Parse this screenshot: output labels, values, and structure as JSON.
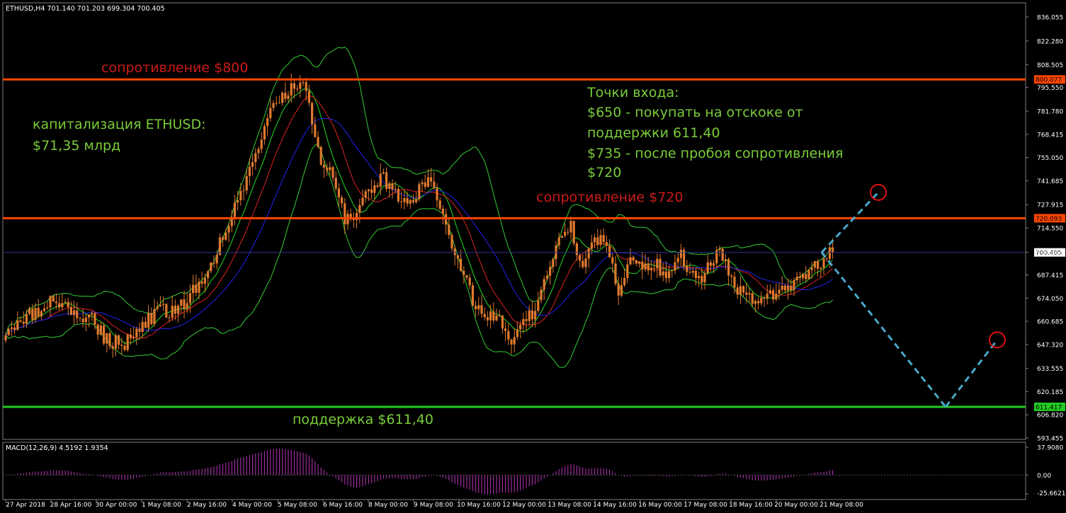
{
  "header": {
    "symbol_info": "ETHUSD,H4  701.140 701.203 699.304 700.405"
  },
  "macd": {
    "info": "MACD(12,26,9) 4.5192 1.9354"
  },
  "colors": {
    "background": "#000000",
    "candle": "#e07a2f",
    "resistance": "#ff4500",
    "support": "#22cc22",
    "annotation_green": "#7acc3a",
    "annotation_red": "#cc1a1a",
    "projection": "#4aa8c8",
    "bb": "#33cc33",
    "ma_fast": "#22dd22",
    "ma_red": "#dd2222",
    "ma_blue": "#2222ee",
    "macd": "#bb33bb",
    "axis_text": "#ffffff",
    "grid_frame": "#808080"
  },
  "annotations": {
    "res800": "сопротивление $800",
    "res720": "сопротивление $720",
    "support": "поддержка $611,40",
    "cap_line1": "капитализация ETHUSD:",
    "cap_line2": "$71,35 млрд",
    "entry_line1": "Точки входа:",
    "entry_line2": "$650 - покупать на отскоке от",
    "entry_line3": "поддержки 611,40",
    "entry_line4": "$735 - после пробоя сопротивления",
    "entry_line5": "$720"
  },
  "chart_data": {
    "type": "candlestick",
    "symbol": "ETHUSD",
    "timeframe": "H4",
    "y_ticks": [
      "836.055",
      "822.280",
      "808.505",
      "795.550",
      "781.780",
      "768.415",
      "755.050",
      "741.685",
      "727.915",
      "714.550",
      "700.405",
      "687.415",
      "674.050",
      "660.685",
      "647.320",
      "633.555",
      "620.185",
      "606.820",
      "593.455"
    ],
    "levels": [
      {
        "name": "resistance-800",
        "value": 800.077,
        "label": "800.077"
      },
      {
        "name": "resistance-720",
        "value": 720.093,
        "label": "720.093"
      },
      {
        "name": "support-611",
        "value": 611.417,
        "label": "611.417"
      }
    ],
    "current_price": {
      "value": 700.405,
      "label": "700.405"
    },
    "x_labels": [
      "27 Apr 2018",
      "28 Apr 16:00",
      "30 Apr 00:00",
      "1 May 08:00",
      "2 May 16:00",
      "4 May 00:00",
      "5 May 08:00",
      "6 May 16:00",
      "8 May 00:00",
      "9 May 08:00",
      "10 May 16:00",
      "12 May 00:00",
      "13 May 08:00",
      "14 May 16:00",
      "16 May 00:00",
      "17 May 08:00",
      "18 May 16:00",
      "20 May 00:00",
      "21 May 08:00"
    ],
    "close_path": [
      [
        0,
        655
      ],
      [
        8,
        664
      ],
      [
        16,
        672
      ],
      [
        22,
        666
      ],
      [
        28,
        664
      ],
      [
        34,
        650
      ],
      [
        40,
        648
      ],
      [
        46,
        660
      ],
      [
        52,
        666
      ],
      [
        58,
        668
      ],
      [
        62,
        675
      ],
      [
        68,
        690
      ],
      [
        78,
        730
      ],
      [
        84,
        760
      ],
      [
        90,
        785
      ],
      [
        95,
        795
      ],
      [
        100,
        800
      ],
      [
        102,
        785
      ],
      [
        106,
        750
      ],
      [
        110,
        745
      ],
      [
        114,
        720
      ],
      [
        118,
        720
      ],
      [
        122,
        735
      ],
      [
        126,
        745
      ],
      [
        130,
        735
      ],
      [
        134,
        728
      ],
      [
        137,
        730
      ],
      [
        140,
        740
      ],
      [
        143,
        742
      ],
      [
        146,
        728
      ],
      [
        150,
        700
      ],
      [
        154,
        690
      ],
      [
        158,
        668
      ],
      [
        162,
        665
      ],
      [
        166,
        660
      ],
      [
        170,
        645
      ],
      [
        174,
        660
      ],
      [
        178,
        668
      ],
      [
        182,
        690
      ],
      [
        186,
        710
      ],
      [
        190,
        716
      ],
      [
        194,
        690
      ],
      [
        198,
        710
      ],
      [
        202,
        705
      ],
      [
        206,
        680
      ],
      [
        210,
        700
      ],
      [
        214,
        690
      ],
      [
        218,
        695
      ],
      [
        222,
        685
      ],
      [
        226,
        700
      ],
      [
        230,
        690
      ],
      [
        234,
        686
      ],
      [
        240,
        700
      ],
      [
        246,
        680
      ],
      [
        252,
        670
      ],
      [
        258,
        675
      ],
      [
        264,
        682
      ],
      [
        270,
        690
      ],
      [
        274,
        693
      ],
      [
        277,
        703
      ],
      [
        278,
        700
      ]
    ],
    "macd_hist_range": [
      -25.6621,
      37.908
    ],
    "macd_ticks": [
      "37.9080",
      "0.00",
      "-25.6621"
    ],
    "projection": [
      [
        700.4,
        "start"
      ],
      [
        735,
        "target-up"
      ],
      [
        611.4,
        "support"
      ],
      [
        650,
        "target-rebound"
      ]
    ]
  }
}
